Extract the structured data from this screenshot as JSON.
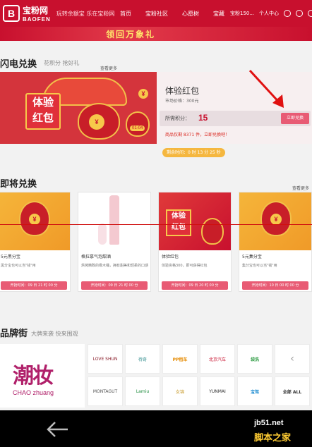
{
  "topnav": {
    "logo_letter": "B",
    "logo_cn": "宝粉网",
    "logo_en": "BAOFEN",
    "slogan": "玩转余额宝 乐在宝粉网",
    "items": [
      "首页",
      "宝粉社区",
      "心愿树",
      "宝藏"
    ],
    "user": "宝粉150...",
    "personal": "个人中心"
  },
  "banner": {
    "text": "领回万象礼"
  },
  "flash": {
    "title": "闪电兑换",
    "subtitle": "花积分 抢好礼",
    "more": "查看更多",
    "card_text": "体验\n红包",
    "product_name": "体验红包",
    "market_price": "市场价格：300元",
    "points_label": "所需积分：",
    "points_value": "15",
    "button": "立即兑换",
    "note": "商品仅剩 8371 件，立即兑换吧！",
    "time_left": "剩余时间：0 时 13 分 25 秒",
    "badge": "01-04"
  },
  "upcoming": {
    "title": "即将兑换",
    "more": "查看更多",
    "cards": [
      {
        "name": "5元黑分宝",
        "desc": "黑分宝也可以当\"钱\"用",
        "time": "开抢时间：09 日 21 时 00 分"
      },
      {
        "name": "格拉慕气泡甜酒",
        "desc": "烘烤精致的橡木桶，拥有甜美和轻柔的口感",
        "time": "开抢时间：09 日 21 时 00 分"
      },
      {
        "name": "体验红包",
        "desc": "体验资格300，即可获得红包",
        "time": "开抢时间：09 日 20 时 00 分"
      },
      {
        "name": "5元集分宝",
        "desc": "集分宝也可以当\"钱\"用",
        "time": "开抢时间：10 日 00 时 00 分"
      }
    ]
  },
  "brands": {
    "title": "品牌街",
    "subtitle": "大牌来袭 快来围观",
    "featured_cn": "潮妆",
    "featured_en": "CHAO zhuang",
    "row1": [
      "LOVE SHUN",
      "待奇",
      "PP租车",
      "北京汽车",
      "袋洗",
      "‹"
    ],
    "row2": [
      "MONTAGUT",
      "Lamiu",
      "女锦",
      "YUNMAI",
      "宝驾",
      "全部 ALL"
    ]
  },
  "watermark": {
    "site": "jb51.net",
    "name": "脚本之家"
  },
  "colors": {
    "brand_red": "#c8102e",
    "button_pink": "#e85b74",
    "gold": "#f7c84a"
  }
}
